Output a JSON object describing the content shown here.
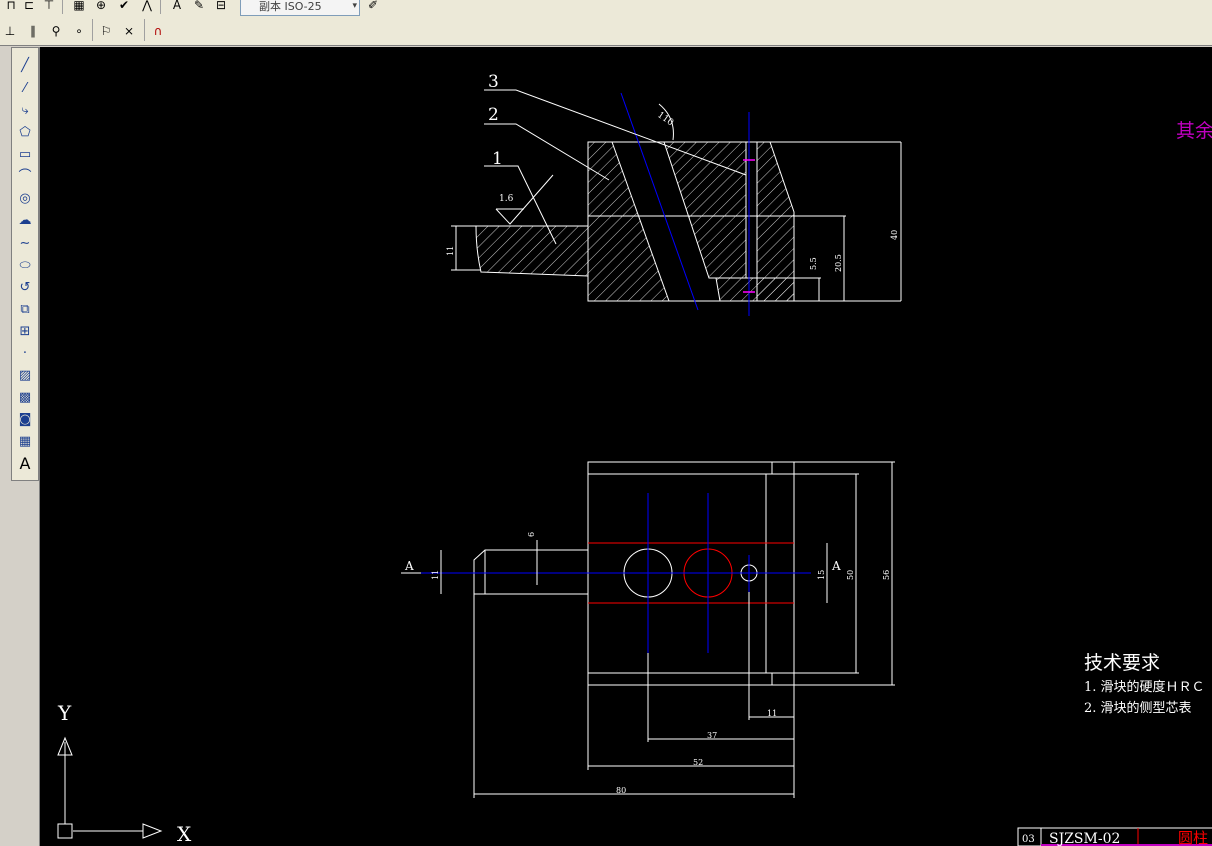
{
  "toolbar": {
    "dimstyle_combo": "副本 ISO-25",
    "combo_arrow": "▾"
  },
  "drawing": {
    "leader_labels": [
      "3",
      "2",
      "1"
    ],
    "roughness_value": "1.6",
    "angle_label": "110",
    "section_dims": {
      "left": "11",
      "d1": "5.5",
      "d2": "20.5",
      "height": "40"
    },
    "plan_dims": {
      "d6": "6",
      "d11_left": "11",
      "d15": "15",
      "d50": "50",
      "d56": "56",
      "d11_bottom": "11",
      "d37": "37",
      "d52": "52",
      "d80": "80"
    },
    "section_label_left": "A",
    "section_label_right": "A",
    "note_corner": "其余",
    "tech_title": "技术要求",
    "tech_item_1": "1. 滑块的硬度ＨＲＣ",
    "tech_item_2": "2.  滑块的侧型芯表",
    "title_code": "03",
    "title_drawing_no": "SJZSM-02",
    "title_name": "圆柱",
    "ucs_y": "Y",
    "ucs_x": "X"
  },
  "colors": {
    "canvas_bg": "#000000",
    "center_line": "#0000ff",
    "highlight": "#ff0000",
    "magenta_text": "#c000c0"
  }
}
